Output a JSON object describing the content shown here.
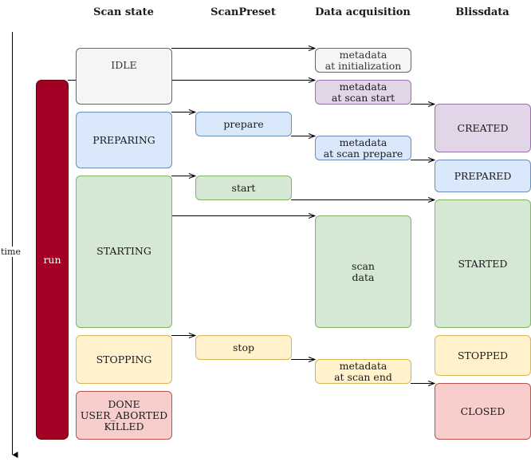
{
  "headers": {
    "scan_state": "Scan state",
    "scan_preset": "ScanPreset",
    "data_acquisition": "Data acquisition",
    "blissdata": "Blissdata"
  },
  "timeline": {
    "label": "time",
    "direction": "down"
  },
  "run": {
    "label": "run"
  },
  "scan_states": {
    "idle": "IDLE",
    "preparing": "PREPARING",
    "starting": "STARTING",
    "stopping": "STOPPING",
    "final": "DONE\nUSER_ABORTED\nKILLED"
  },
  "presets": {
    "prepare": "prepare",
    "start": "start",
    "stop": "stop"
  },
  "acquisition": {
    "init": "metadata\nat initialization",
    "scan_start": "metadata\nat scan start",
    "scan_prepare": "metadata\nat scan prepare",
    "scan_data": "scan\ndata",
    "scan_end": "metadata\nat scan end"
  },
  "blissdata": {
    "created": "CREATED",
    "prepared": "PREPARED",
    "started": "STARTED",
    "stopped": "STOPPED",
    "closed": "CLOSED"
  },
  "colors": {
    "gray": "#f5f5f5",
    "purple": "#e1d5e7",
    "blue": "#dae8fc",
    "green": "#d5e8d4",
    "yellow": "#fff2cc",
    "red": "#f8cecc",
    "run": "#a20025"
  }
}
